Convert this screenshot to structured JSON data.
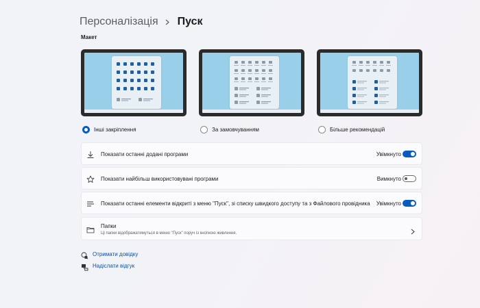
{
  "header": {
    "parent": "Персоналізація",
    "current": "Пуск"
  },
  "layout_section": {
    "label": "Макет",
    "options": [
      {
        "label": "Інші закріплення",
        "selected": true
      },
      {
        "label": "За замовчуванням",
        "selected": false
      },
      {
        "label": "Більше рекомендацій",
        "selected": false
      }
    ]
  },
  "settings": [
    {
      "label": "Показати останні додані програми",
      "status": "Увімкнуто",
      "on": true,
      "icon": "download-icon"
    },
    {
      "label": "Показати найбільш використовувані програми",
      "status": "Вимкнуто",
      "on": false,
      "icon": "star-icon"
    },
    {
      "label": "Показати останні елементи відкриті з меню \"Пуск\", зі списку швидкого доступу та з Файлового провідника",
      "status": "Увімкнуто",
      "on": true,
      "icon": "list-icon"
    }
  ],
  "folders": {
    "title": "Папки",
    "description": "Ці папки відображатимуться в меню \"Пуск\" поруч із кнопкою живлення.",
    "icon": "folder-icon"
  },
  "links": {
    "help": "Отримати довідку",
    "feedback": "Надіслати відгук"
  },
  "colors": {
    "accent": "#0a5bc0",
    "link": "#0a4fa8",
    "screen": "#99cfe9"
  }
}
